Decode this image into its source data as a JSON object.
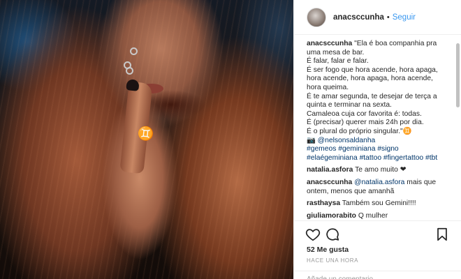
{
  "post": {
    "username": "anacsccunha",
    "follow_label": "Seguir",
    "separator": "•",
    "tattoo_glyph": "♊"
  },
  "caption": {
    "username": "anacsccunha",
    "lines": [
      "\"Ela é boa companhia pra",
      "uma mesa de bar.",
      "É falar, falar e falar.",
      "É ser fogo que hora acende, hora apaga,",
      "hora acende, hora apaga, hora acende,",
      "hora queima.",
      "É te amar segunda, te desejar de terça a",
      "quinta e terminar na sexta.",
      "Camaleoa cuja cor favorita é: todas.",
      "É (precisar) querer mais 24h por dia.",
      "É o plural do próprio singular.\"♊",
      "📷 @nelsonsaldanha"
    ],
    "hashtags_line1": "#gemeos #geminiana #signo",
    "hashtags_line2": "#elaégeminiana #tattoo #fingertattoo #tbt"
  },
  "comments": [
    {
      "user": "natalia.asfora",
      "text": "Te amo muito ❤"
    },
    {
      "user": "anacsccunha",
      "mention": "@natalia.asfora",
      "text_1": "mais que",
      "text_2": "ontem, menos que amanhã"
    },
    {
      "user": "rasthaysa",
      "text": "Também sou Gemini!!!!"
    },
    {
      "user": "giuliamorabito",
      "text": "Q mulher"
    }
  ],
  "actions": {
    "like_icon": "heart-icon",
    "comment_icon": "comment-icon",
    "save_icon": "bookmark-icon"
  },
  "likes_text": "52 Me gusta",
  "time_ago": "HACE UNA HORA",
  "add_comment_placeholder": "Añade un comentario..."
}
